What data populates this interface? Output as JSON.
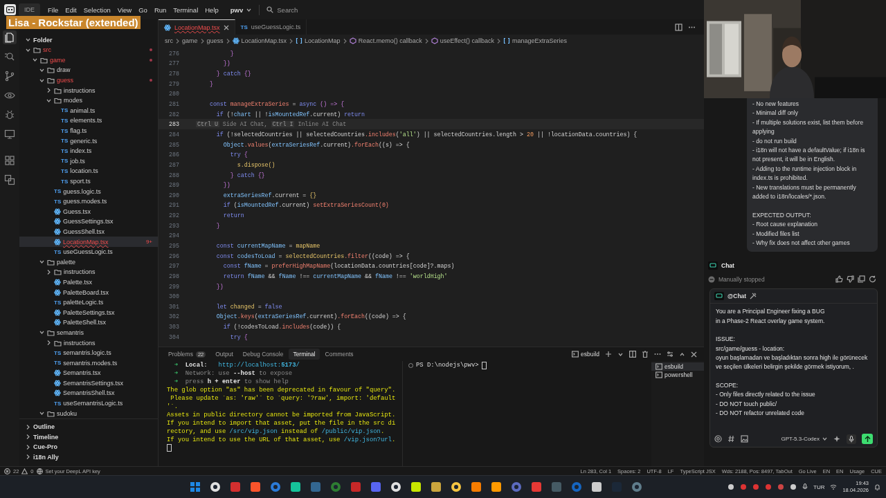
{
  "window": {
    "app_label": "IDE",
    "menus": [
      "File",
      "Edit",
      "Selection",
      "View",
      "Go",
      "Run",
      "Terminal",
      "Help"
    ],
    "workspace": "pwv",
    "search_placeholder": "Search"
  },
  "overlay": {
    "text": "Lisa - Rockstar (extended)"
  },
  "sidebar": {
    "section": "Folder",
    "tree": [
      {
        "label": "src",
        "kind": "folder",
        "expanded": true,
        "error": true,
        "selected": false,
        "children": [
          {
            "label": "game",
            "kind": "folder",
            "expanded": true,
            "error": true,
            "selected": false,
            "children": [
              {
                "label": "draw",
                "kind": "folder",
                "expanded": true,
                "error": false,
                "selected": false
              },
              {
                "label": "guess",
                "kind": "folder",
                "expanded": true,
                "error": true,
                "selected": false,
                "children": [
                  {
                    "label": "instructions",
                    "kind": "folder",
                    "expanded": false,
                    "error": false,
                    "selected": false
                  },
                  {
                    "label": "modes",
                    "kind": "folder",
                    "expanded": true,
                    "error": false,
                    "selected": false,
                    "children": [
                      {
                        "label": "animal.ts",
                        "kind": "ts",
                        "type_label": "TS",
                        "error": false,
                        "selected": false
                      },
                      {
                        "label": "elements.ts",
                        "kind": "ts",
                        "type_label": "TS",
                        "error": false,
                        "selected": false
                      },
                      {
                        "label": "flag.ts",
                        "kind": "ts",
                        "type_label": "TS",
                        "error": false,
                        "selected": false
                      },
                      {
                        "label": "generic.ts",
                        "kind": "ts",
                        "type_label": "TS",
                        "error": false,
                        "selected": false
                      },
                      {
                        "label": "index.ts",
                        "kind": "ts",
                        "type_label": "TS",
                        "error": false,
                        "selected": false
                      },
                      {
                        "label": "job.ts",
                        "kind": "ts",
                        "type_label": "TS",
                        "error": false,
                        "selected": false
                      },
                      {
                        "label": "location.ts",
                        "kind": "ts",
                        "type_label": "TS",
                        "error": false,
                        "selected": false
                      },
                      {
                        "label": "sport.ts",
                        "kind": "ts",
                        "type_label": "TS",
                        "error": false,
                        "selected": false
                      }
                    ]
                  },
                  {
                    "label": "guess.logic.ts",
                    "kind": "ts",
                    "type_label": "TS",
                    "error": false,
                    "selected": false
                  },
                  {
                    "label": "guess.modes.ts",
                    "kind": "ts",
                    "type_label": "TS",
                    "error": false,
                    "selected": false
                  },
                  {
                    "label": "Guess.tsx",
                    "kind": "tsx",
                    "error": false,
                    "selected": false
                  },
                  {
                    "label": "GuessSettings.tsx",
                    "kind": "tsx",
                    "error": false,
                    "selected": false
                  },
                  {
                    "label": "GuessShell.tsx",
                    "kind": "tsx",
                    "error": false,
                    "selected": false
                  },
                  {
                    "label": "LocationMap.tsx",
                    "kind": "tsx",
                    "error": true,
                    "badge": "9+",
                    "selected": true
                  },
                  {
                    "label": "useGuessLogic.ts",
                    "kind": "ts",
                    "type_label": "TS",
                    "error": false,
                    "selected": false
                  }
                ]
              },
              {
                "label": "palette",
                "kind": "folder",
                "expanded": true,
                "error": false,
                "selected": false,
                "children": [
                  {
                    "label": "instructions",
                    "kind": "folder",
                    "expanded": false,
                    "error": false,
                    "selected": false
                  },
                  {
                    "label": "Palette.tsx",
                    "kind": "tsx",
                    "error": false,
                    "selected": false
                  },
                  {
                    "label": "PaletteBoard.tsx",
                    "kind": "tsx",
                    "error": false,
                    "selected": false
                  },
                  {
                    "label": "paletteLogic.ts",
                    "kind": "ts",
                    "type_label": "TS",
                    "error": false,
                    "selected": false
                  },
                  {
                    "label": "PaletteSettings.tsx",
                    "kind": "tsx",
                    "error": false,
                    "selected": false
                  },
                  {
                    "label": "PaletteShell.tsx",
                    "kind": "tsx",
                    "error": false,
                    "selected": false
                  }
                ]
              },
              {
                "label": "semantris",
                "kind": "folder",
                "expanded": true,
                "error": false,
                "selected": false,
                "children": [
                  {
                    "label": "instructions",
                    "kind": "folder",
                    "expanded": false,
                    "error": false,
                    "selected": false
                  },
                  {
                    "label": "semantris.logic.ts",
                    "kind": "ts",
                    "type_label": "TS",
                    "error": false,
                    "selected": false
                  },
                  {
                    "label": "semantris.modes.ts",
                    "kind": "ts",
                    "type_label": "TS",
                    "error": false,
                    "selected": false
                  },
                  {
                    "label": "Semantris.tsx",
                    "kind": "tsx",
                    "error": false,
                    "selected": false
                  },
                  {
                    "label": "SemantrisSettings.tsx",
                    "kind": "tsx",
                    "error": false,
                    "selected": false
                  },
                  {
                    "label": "SemantrisShell.tsx",
                    "kind": "tsx",
                    "error": false,
                    "selected": false
                  },
                  {
                    "label": "useSemantrisLogic.ts",
                    "kind": "ts",
                    "type_label": "TS",
                    "error": false,
                    "selected": false
                  }
                ]
              },
              {
                "label": "sudoku",
                "kind": "folder",
                "expanded": true,
                "error": false,
                "selected": false
              }
            ]
          }
        ]
      }
    ],
    "bottom_sections": [
      "Outline",
      "Timeline",
      "Cue-Pro",
      "i18n Ally"
    ]
  },
  "editor": {
    "tabs": [
      {
        "label": "LocationMap.tsx",
        "kind": "tsx",
        "selected": true,
        "error": true
      },
      {
        "label": "useGuessLogic.ts",
        "kind": "ts",
        "type_label": "TS",
        "selected": false,
        "error": false
      }
    ],
    "breadcrumbs": [
      {
        "label": "src",
        "kind": "folder"
      },
      {
        "label": "game",
        "kind": "folder"
      },
      {
        "label": "guess",
        "kind": "folder"
      },
      {
        "label": "LocationMap.tsx",
        "kind": "tsx"
      },
      {
        "label": "LocationMap",
        "kind": "symbol"
      },
      {
        "label": "React.memo() callback",
        "kind": "function"
      },
      {
        "label": "useEffect() callback",
        "kind": "function"
      },
      {
        "label": "manageExtraSeries",
        "kind": "symbol"
      }
    ],
    "lines": [
      {
        "number": "276",
        "current": false,
        "tokens": [
          {
            "t": "          }",
            "kind": "bracket"
          }
        ]
      },
      {
        "number": "277",
        "current": false,
        "tokens": [
          {
            "t": "        })",
            "kind": "bracket"
          }
        ]
      },
      {
        "number": "278",
        "current": false,
        "tokens": [
          {
            "t": "      } ",
            "kind": "bracket"
          },
          {
            "t": "catch",
            "kind": "keyword"
          },
          {
            "t": " {}",
            "kind": "bracket"
          }
        ]
      },
      {
        "number": "279",
        "current": false,
        "tokens": [
          {
            "t": "    }",
            "kind": "bracket"
          }
        ]
      },
      {
        "number": "280",
        "current": false
      },
      {
        "number": "281",
        "current": false,
        "tokens": [
          {
            "t": "    const ",
            "kind": "keyword"
          },
          {
            "t": "manageExtraSeries",
            "kind": "function"
          },
          {
            "t": " = ",
            "kind": "plain"
          },
          {
            "t": "async",
            "kind": "keyword"
          },
          {
            "t": " () => {",
            "kind": "bracket"
          }
        ]
      },
      {
        "number": "282",
        "current": false,
        "tokens": [
          {
            "t": "      if ",
            "kind": "keyword"
          },
          {
            "t": "(!",
            "kind": "plain"
          },
          {
            "t": "chart",
            "kind": "variable"
          },
          {
            "t": " || !",
            "kind": "plain"
          },
          {
            "t": "isMountedRef",
            "kind": "variable"
          },
          {
            "t": ".current) ",
            "kind": "plain"
          },
          {
            "t": "return",
            "kind": "keyword"
          }
        ]
      },
      {
        "number": "283",
        "current": true,
        "tokens": [
          {
            "t": "Ctrl U",
            "kind": "key"
          },
          {
            "t": " Side AI Chat, ",
            "kind": "hint"
          },
          {
            "t": "Ctrl I",
            "kind": "key"
          },
          {
            "t": " Inline AI Chat",
            "kind": "hint"
          }
        ]
      },
      {
        "number": "284",
        "current": false,
        "tokens": [
          {
            "t": "      if ",
            "kind": "keyword"
          },
          {
            "t": "(!selectedCountries || selectedCountries",
            "kind": "plain"
          },
          {
            "t": ".includes",
            "kind": "function"
          },
          {
            "t": "(",
            "kind": "plain"
          },
          {
            "t": "'all'",
            "kind": "string"
          },
          {
            "t": ") || selectedCountries.length > ",
            "kind": "plain"
          },
          {
            "t": "20",
            "kind": "number"
          },
          {
            "t": " || !locationData.countries) {",
            "kind": "plain"
          }
        ]
      },
      {
        "number": "285",
        "current": false,
        "tokens": [
          {
            "t": "        Object",
            "kind": "variable"
          },
          {
            "t": ".values",
            "kind": "function"
          },
          {
            "t": "(",
            "kind": "plain"
          },
          {
            "t": "extraSeriesRef",
            "kind": "variable"
          },
          {
            "t": ".current)",
            "kind": "plain"
          },
          {
            "t": ".forEach",
            "kind": "function"
          },
          {
            "t": "((s) => {",
            "kind": "plain"
          }
        ]
      },
      {
        "number": "286",
        "current": false,
        "tokens": [
          {
            "t": "          try",
            "kind": "keyword"
          },
          {
            "t": " {",
            "kind": "bracket"
          }
        ]
      },
      {
        "number": "287",
        "current": false,
        "tokens": [
          {
            "t": "            s.dispose()",
            "kind": "constant"
          }
        ]
      },
      {
        "number": "288",
        "current": false,
        "tokens": [
          {
            "t": "          } ",
            "kind": "bracket"
          },
          {
            "t": "catch",
            "kind": "keyword"
          },
          {
            "t": " {}",
            "kind": "bracket"
          }
        ]
      },
      {
        "number": "289",
        "current": false,
        "tokens": [
          {
            "t": "        })",
            "kind": "bracket"
          }
        ]
      },
      {
        "number": "290",
        "current": false,
        "tokens": [
          {
            "t": "        extraSeriesRef",
            "kind": "variable"
          },
          {
            "t": ".current = ",
            "kind": "plain"
          },
          {
            "t": "{}",
            "kind": "constant"
          }
        ]
      },
      {
        "number": "291",
        "current": false,
        "tokens": [
          {
            "t": "        if ",
            "kind": "keyword"
          },
          {
            "t": "(",
            "kind": "plain"
          },
          {
            "t": "isMountedRef",
            "kind": "variable"
          },
          {
            "t": ".current) ",
            "kind": "plain"
          },
          {
            "t": "setExtraSeriesCount(0)",
            "kind": "function"
          }
        ]
      },
      {
        "number": "292",
        "current": false,
        "tokens": [
          {
            "t": "        return",
            "kind": "keyword"
          }
        ]
      },
      {
        "number": "293",
        "current": false,
        "tokens": [
          {
            "t": "      }",
            "kind": "bracket"
          }
        ]
      },
      {
        "number": "294",
        "current": false
      },
      {
        "number": "295",
        "current": false,
        "tokens": [
          {
            "t": "      const ",
            "kind": "keyword"
          },
          {
            "t": "currentMapName",
            "kind": "variable"
          },
          {
            "t": " = ",
            "kind": "plain"
          },
          {
            "t": "mapName",
            "kind": "constant"
          }
        ]
      },
      {
        "number": "296",
        "current": false,
        "tokens": [
          {
            "t": "      const ",
            "kind": "keyword"
          },
          {
            "t": "codesToLoad",
            "kind": "variable"
          },
          {
            "t": " = ",
            "kind": "plain"
          },
          {
            "t": "selectedCountries",
            "kind": "constant"
          },
          {
            "t": ".filter",
            "kind": "function"
          },
          {
            "t": "((code) => {",
            "kind": "plain"
          }
        ]
      },
      {
        "number": "297",
        "current": false,
        "tokens": [
          {
            "t": "        const ",
            "kind": "keyword"
          },
          {
            "t": "fName",
            "kind": "variable"
          },
          {
            "t": " = ",
            "kind": "plain"
          },
          {
            "t": "preferHighMapName",
            "kind": "function"
          },
          {
            "t": "(locationData.countries[code]?.maps)",
            "kind": "plain"
          }
        ]
      },
      {
        "number": "298",
        "current": false,
        "tokens": [
          {
            "t": "        return ",
            "kind": "keyword"
          },
          {
            "t": "fName",
            "kind": "variable"
          },
          {
            "t": " && ",
            "kind": "plain"
          },
          {
            "t": "fName",
            "kind": "variable"
          },
          {
            "t": " !== ",
            "kind": "plain"
          },
          {
            "t": "currentMapName",
            "kind": "variable"
          },
          {
            "t": " && ",
            "kind": "plain"
          },
          {
            "t": "fName",
            "kind": "variable"
          },
          {
            "t": " !== ",
            "kind": "plain"
          },
          {
            "t": "'worldHigh'",
            "kind": "string"
          }
        ]
      },
      {
        "number": "299",
        "current": false,
        "tokens": [
          {
            "t": "      })",
            "kind": "bracket"
          }
        ]
      },
      {
        "number": "300",
        "current": false
      },
      {
        "number": "301",
        "current": false,
        "tokens": [
          {
            "t": "      let ",
            "kind": "keyword"
          },
          {
            "t": "changed",
            "kind": "constant"
          },
          {
            "t": " = ",
            "kind": "plain"
          },
          {
            "t": "false",
            "kind": "keyword"
          }
        ]
      },
      {
        "number": "302",
        "current": false,
        "tokens": [
          {
            "t": "      Object",
            "kind": "variable"
          },
          {
            "t": ".keys",
            "kind": "function"
          },
          {
            "t": "(",
            "kind": "plain"
          },
          {
            "t": "extraSeriesRef",
            "kind": "variable"
          },
          {
            "t": ".current)",
            "kind": "plain"
          },
          {
            "t": ".forEach",
            "kind": "function"
          },
          {
            "t": "((code) => {",
            "kind": "plain"
          }
        ]
      },
      {
        "number": "303",
        "current": false,
        "tokens": [
          {
            "t": "        if ",
            "kind": "keyword"
          },
          {
            "t": "(!codesToLoad",
            "kind": "plain"
          },
          {
            "t": ".includes",
            "kind": "function"
          },
          {
            "t": "(code)) {",
            "kind": "plain"
          }
        ]
      },
      {
        "number": "304",
        "current": false,
        "tokens": [
          {
            "t": "          try",
            "kind": "keyword"
          },
          {
            "t": " {",
            "kind": "bracket"
          }
        ]
      }
    ]
  },
  "panel": {
    "tabs": [
      {
        "label": "Problems",
        "badge": "22",
        "selected": false
      },
      {
        "label": "Output",
        "selected": false
      },
      {
        "label": "Debug Console",
        "selected": false
      },
      {
        "label": "Terminal",
        "selected": true
      },
      {
        "label": "Comments",
        "selected": false
      }
    ],
    "active_terminal": "esbuild",
    "terminal_left": [
      {
        "tokens": [
          {
            "t": "  ➜  ",
            "kind": "arrow"
          },
          {
            "t": "Local",
            "kind": "bold"
          },
          {
            "t": ":   ",
            "kind": "plain"
          },
          {
            "t": "http://localhost:",
            "kind": "link"
          },
          {
            "t": "5173",
            "kind": "boldlink"
          },
          {
            "t": "/",
            "kind": "link"
          }
        ]
      },
      {
        "tokens": [
          {
            "t": "  ➜  ",
            "kind": "arrow"
          },
          {
            "t": "Network: use ",
            "kind": "dim"
          },
          {
            "t": "--host",
            "kind": "bold"
          },
          {
            "t": " to expose",
            "kind": "dim"
          }
        ]
      },
      {
        "tokens": [
          {
            "t": "  ➜  ",
            "kind": "arrow"
          },
          {
            "t": "press ",
            "kind": "dim"
          },
          {
            "t": "h + enter",
            "kind": "bold"
          },
          {
            "t": " to show help",
            "kind": "dim"
          }
        ]
      },
      {
        "tokens": [
          {
            "t": "The glob option \"as\" has been deprecated in favour of \"query\".",
            "kind": "warning"
          }
        ]
      },
      {
        "tokens": [
          {
            "t": " Please update `as: 'raw'` to `query: '?raw', import: 'default",
            "kind": "warning"
          }
        ]
      },
      {
        "tokens": [
          {
            "t": "'`.",
            "kind": "warning"
          }
        ]
      },
      {
        "tokens": [
          {
            "t": "Assets in public directory cannot be imported from JavaScript.",
            "kind": "warning"
          }
        ]
      },
      {
        "tokens": [
          {
            "t": "If you intend to import that asset, put the file in the src di",
            "kind": "warning"
          }
        ]
      },
      {
        "tokens": [
          {
            "t": "rectory, and use ",
            "kind": "warning"
          },
          {
            "t": "/src/vip.json",
            "kind": "link"
          },
          {
            "t": " instead of ",
            "kind": "warning"
          },
          {
            "t": "/public/vip.json",
            "kind": "link"
          },
          {
            "t": ".",
            "kind": "warning"
          }
        ]
      },
      {
        "tokens": [
          {
            "t": "If you intend to use the URL of that asset, use ",
            "kind": "warning"
          },
          {
            "t": "/vip.json?url",
            "kind": "link"
          },
          {
            "t": ".",
            "kind": "warning"
          }
        ]
      }
    ],
    "terminal_right_prompt": "PS D:\\nodejs\\pwv>",
    "terminals": [
      {
        "label": "esbuild",
        "selected": true
      },
      {
        "label": "powershell",
        "selected": false
      }
    ]
  },
  "chat": {
    "message": [
      [
        "- No new features",
        "- Minimal diff only",
        "- If multiple solutions exist, list them before applying",
        "- do not run build",
        "- i18n will not have a defaultValue; if i18n is not present, it will be in English.",
        "- Adding to the runtime injection block in index.ts is prohibited.",
        "- New translations must be permanently added to i18n/locales/*.json."
      ],
      [
        "EXPECTED OUTPUT:",
        "- Root cause explanation",
        "- Modified files list",
        "- Why fix does not affect other games"
      ]
    ],
    "title": "Chat",
    "status": "Manually stopped",
    "input": {
      "mention": "@Chat",
      "paragraphs": [
        [
          "You are a Principal Engineer fixing a BUG",
          "in a Phase-2 React overlay game system."
        ],
        [
          "ISSUE:",
          "src/game/guess - location:",
          "oyun başlamadan ve başladıktan sonra high ile görünecek ve seçilen ülkeleri belirgin şekilde görmek istiyorum, ."
        ],
        [
          "SCOPE:",
          "- Only files directly related to the issue",
          "- DO NOT touch public/",
          "- DO NOT refactor unrelated code"
        ]
      ],
      "model": "GPT-5.3-Codex"
    }
  },
  "status_bar": {
    "errors": "22",
    "warnings": "0",
    "deepl": "Set your DeepL API key",
    "right": [
      "Ln 283, Col 1",
      "Spaces: 2",
      "UTF-8",
      "LF",
      "TypeScript JSX",
      "Wds: 2188, Pos: 8497, TabOut",
      "Go Live",
      "EN",
      "EN",
      "Usage",
      "CUE"
    ]
  },
  "taskbar": {
    "language": "TUR",
    "time": "19:43",
    "date": "18.04.2026"
  }
}
